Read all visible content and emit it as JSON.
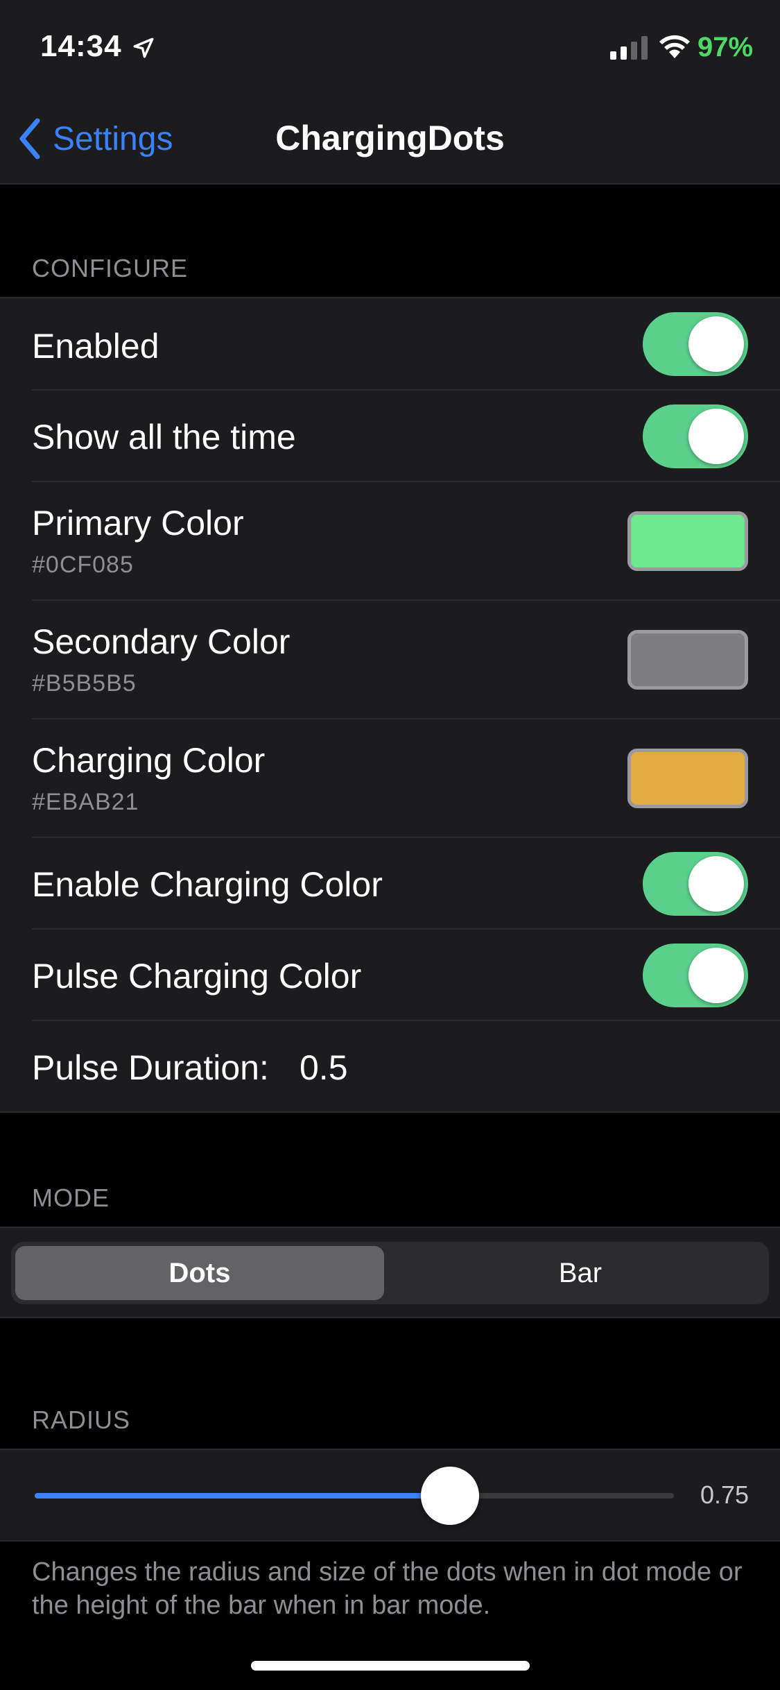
{
  "status_bar": {
    "time": "14:34",
    "battery_percent": "97%",
    "icons": [
      "location-arrow-icon",
      "cellular-signal-icon",
      "wifi-icon"
    ]
  },
  "nav": {
    "back_label": "Settings",
    "title": "ChargingDots"
  },
  "configure": {
    "header": "CONFIGURE",
    "enabled": {
      "label": "Enabled",
      "on": true
    },
    "show_all_time": {
      "label": "Show all the time",
      "on": true
    },
    "primary_color": {
      "label": "Primary Color",
      "hex": "#0CF085",
      "swatch": "#6de88d"
    },
    "secondary_color": {
      "label": "Secondary Color",
      "hex": "#B5B5B5",
      "swatch": "#7d7d7f"
    },
    "charging_color": {
      "label": "Charging Color",
      "hex": "#EBAB21",
      "swatch": "#e2ac44"
    },
    "enable_charging_color": {
      "label": "Enable Charging Color",
      "on": true
    },
    "pulse_charging_color": {
      "label": "Pulse Charging Color",
      "on": true
    },
    "pulse_duration": {
      "label": "Pulse Duration:",
      "value": "0.5"
    }
  },
  "mode": {
    "header": "MODE",
    "options": [
      "Dots",
      "Bar"
    ],
    "selected": "Dots"
  },
  "radius": {
    "header": "RADIUS",
    "value_label": "0.75",
    "fill_fraction": 0.65,
    "footer": "Changes the radius and size of the dots when in dot mode or the height of the bar when in bar mode."
  },
  "colors": {
    "accent_blue": "#3a82f7",
    "toggle_green": "#5bd08d",
    "battery_green": "#4cd964"
  }
}
